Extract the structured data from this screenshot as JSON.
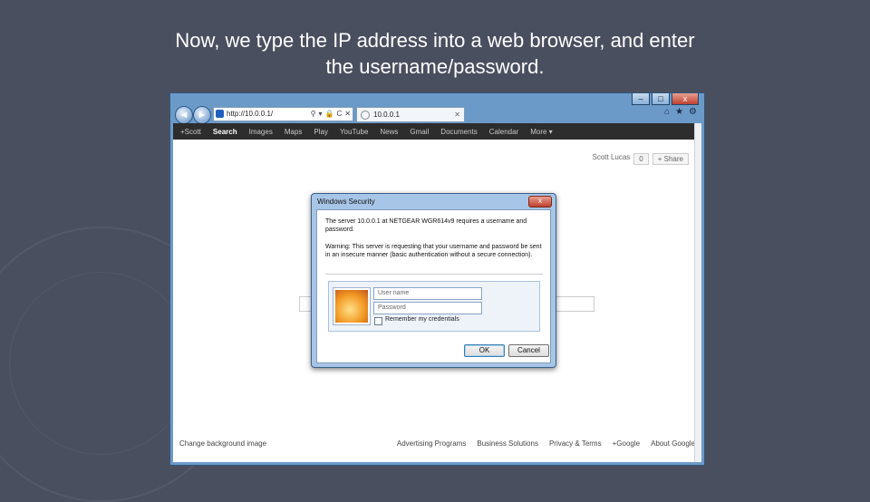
{
  "slide": {
    "title_line1": "Now, we type the IP address into a web browser, and enter",
    "title_line2": "the username/password."
  },
  "browser": {
    "window_controls": [
      "–",
      "□",
      "x"
    ],
    "back_glyph": "◄",
    "forward_glyph": "►",
    "address_value": "http://10.0.0.1/",
    "address_icons": [
      "⚲",
      "▾",
      "🔒",
      "C",
      "✕"
    ],
    "tab_title": "10.0.0.1",
    "tab_close": "✕",
    "toolbar_icons": [
      "⌂",
      "★",
      "⚙"
    ]
  },
  "google_bar": {
    "items": [
      "+Scott",
      "Search",
      "Images",
      "Maps",
      "Play",
      "YouTube",
      "News",
      "Gmail",
      "Documents",
      "Calendar",
      "More ▾"
    ],
    "active_index": 1
  },
  "user_area": {
    "name": "Scott Lucas",
    "count": "0",
    "share": "+ Share"
  },
  "footer": {
    "left": "Change background image",
    "links": [
      "Advertising Programs",
      "Business Solutions",
      "Privacy & Terms",
      "+Google",
      "About Google"
    ]
  },
  "dialog": {
    "title": "Windows Security",
    "close": "x",
    "message": "The server 10.0.0.1 at NETGEAR WGR614v9 requires a username and password.",
    "warning": "Warning: This server is requesting that your username and password be sent in an insecure manner (basic authentication without a secure connection).",
    "username_placeholder": "User name",
    "password_placeholder": "Password",
    "remember_label": "Remember my credentials",
    "ok_label": "OK",
    "cancel_label": "Cancel"
  }
}
